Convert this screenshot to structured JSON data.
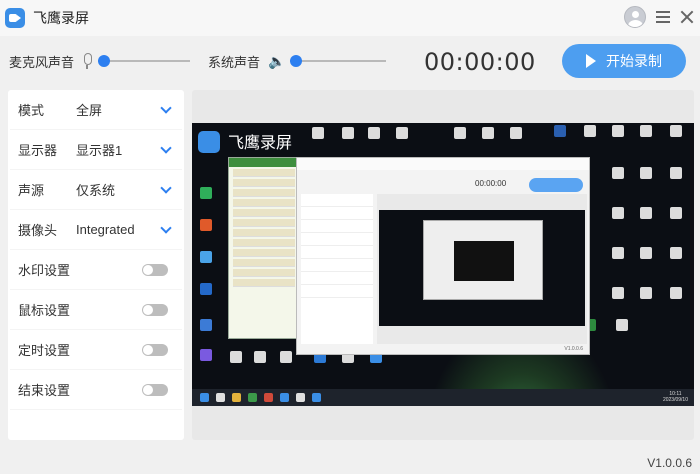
{
  "titlebar": {
    "app_title": "飞鹰录屏"
  },
  "audio": {
    "mic_label": "麦克风声音",
    "mic_volume_percent": 0,
    "system_label": "系统声音",
    "system_volume_percent": 0,
    "speaker_glyph": "🔈"
  },
  "timer": "00:00:00",
  "record_button": {
    "label": "开始录制"
  },
  "settings": {
    "mode": {
      "label": "模式",
      "value": "全屏"
    },
    "display": {
      "label": "显示器",
      "value": "显示器1"
    },
    "sound_source": {
      "label": "声源",
      "value": "仅系统"
    },
    "camera": {
      "label": "摄像头",
      "value": "Integrated"
    },
    "watermark": {
      "label": "水印设置",
      "enabled": false
    },
    "mouse": {
      "label": "鼠标设置",
      "enabled": false
    },
    "schedule": {
      "label": "定时设置",
      "enabled": false
    },
    "end": {
      "label": "结束设置",
      "enabled": false
    }
  },
  "preview": {
    "overlay_title": "飞鹰录屏",
    "mini_timer": "00:00:00",
    "mini_version": "V1.0.0.6",
    "clock_time": "10:11",
    "clock_date": "2023/09/10"
  },
  "colors": {
    "accent": "#2d7ff0",
    "record_button": "#4d9ef0",
    "toggle_off": "#bdbdbd",
    "background": "#f0f0f0"
  },
  "version": "V1.0.0.6"
}
